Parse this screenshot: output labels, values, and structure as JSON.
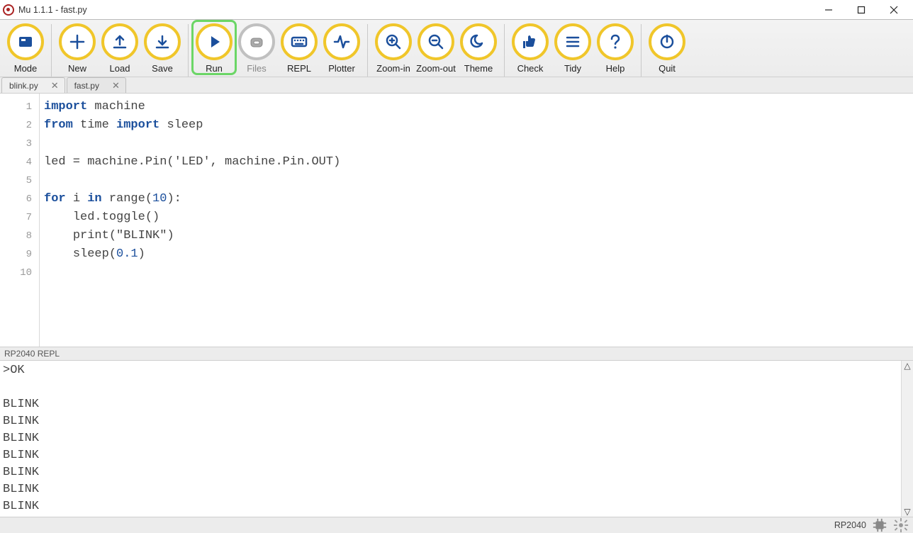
{
  "window": {
    "title": "Mu 1.1.1 - fast.py"
  },
  "toolbar": {
    "items": [
      {
        "id": "mode",
        "label": "Mode",
        "icon": "mode",
        "disabled": false,
        "highlight": false,
        "sep_after": true
      },
      {
        "id": "new",
        "label": "New",
        "icon": "plus",
        "disabled": false,
        "highlight": false,
        "sep_after": false
      },
      {
        "id": "load",
        "label": "Load",
        "icon": "upload",
        "disabled": false,
        "highlight": false,
        "sep_after": false
      },
      {
        "id": "save",
        "label": "Save",
        "icon": "download",
        "disabled": false,
        "highlight": false,
        "sep_after": true
      },
      {
        "id": "run",
        "label": "Run",
        "icon": "play",
        "disabled": false,
        "highlight": true,
        "sep_after": false
      },
      {
        "id": "files",
        "label": "Files",
        "icon": "files",
        "disabled": true,
        "highlight": false,
        "sep_after": false
      },
      {
        "id": "repl",
        "label": "REPL",
        "icon": "keyboard",
        "disabled": false,
        "highlight": false,
        "sep_after": false
      },
      {
        "id": "plotter",
        "label": "Plotter",
        "icon": "pulse",
        "disabled": false,
        "highlight": false,
        "sep_after": true
      },
      {
        "id": "zoomin",
        "label": "Zoom-in",
        "icon": "zoomin",
        "disabled": false,
        "highlight": false,
        "sep_after": false
      },
      {
        "id": "zoomout",
        "label": "Zoom-out",
        "icon": "zoomout",
        "disabled": false,
        "highlight": false,
        "sep_after": false
      },
      {
        "id": "theme",
        "label": "Theme",
        "icon": "moon",
        "disabled": false,
        "highlight": false,
        "sep_after": true
      },
      {
        "id": "check",
        "label": "Check",
        "icon": "thumb",
        "disabled": false,
        "highlight": false,
        "sep_after": false
      },
      {
        "id": "tidy",
        "label": "Tidy",
        "icon": "menu",
        "disabled": false,
        "highlight": false,
        "sep_after": false
      },
      {
        "id": "help",
        "label": "Help",
        "icon": "help",
        "disabled": false,
        "highlight": false,
        "sep_after": true
      },
      {
        "id": "quit",
        "label": "Quit",
        "icon": "power",
        "disabled": false,
        "highlight": false,
        "sep_after": false
      }
    ]
  },
  "tabs": [
    {
      "name": "blink.py",
      "active": false
    },
    {
      "name": "fast.py",
      "active": true
    }
  ],
  "editor": {
    "line_count": 10,
    "lines": [
      {
        "n": 1,
        "tokens": [
          [
            "kw",
            "import"
          ],
          [
            "sp",
            " "
          ],
          [
            "id",
            "machine"
          ]
        ]
      },
      {
        "n": 2,
        "tokens": [
          [
            "kw",
            "from"
          ],
          [
            "sp",
            " "
          ],
          [
            "id",
            "time"
          ],
          [
            "sp",
            " "
          ],
          [
            "kw",
            "import"
          ],
          [
            "sp",
            " "
          ],
          [
            "id",
            "sleep"
          ]
        ]
      },
      {
        "n": 3,
        "tokens": []
      },
      {
        "n": 4,
        "tokens": [
          [
            "id",
            "led = machine.Pin("
          ],
          [
            "str",
            "'LED'"
          ],
          [
            "id",
            ", machine.Pin.OUT)"
          ]
        ]
      },
      {
        "n": 5,
        "tokens": []
      },
      {
        "n": 6,
        "tokens": [
          [
            "kw",
            "for"
          ],
          [
            "sp",
            " "
          ],
          [
            "id",
            "i"
          ],
          [
            "sp",
            " "
          ],
          [
            "kw",
            "in"
          ],
          [
            "sp",
            " "
          ],
          [
            "id",
            "range("
          ],
          [
            "num",
            "10"
          ],
          [
            "id",
            "):"
          ]
        ]
      },
      {
        "n": 7,
        "tokens": [
          [
            "sp",
            "    "
          ],
          [
            "id",
            "led.toggle()"
          ]
        ]
      },
      {
        "n": 8,
        "tokens": [
          [
            "sp",
            "    "
          ],
          [
            "id",
            "print("
          ],
          [
            "str",
            "\"BLINK\""
          ],
          [
            "id",
            ")"
          ]
        ]
      },
      {
        "n": 9,
        "tokens": [
          [
            "sp",
            "    "
          ],
          [
            "id",
            "sleep("
          ],
          [
            "num",
            "0.1"
          ],
          [
            "id",
            ")"
          ]
        ]
      },
      {
        "n": 10,
        "tokens": []
      }
    ]
  },
  "repl": {
    "title": "RP2040 REPL",
    "lines": [
      ">OK",
      "",
      "BLINK",
      "BLINK",
      "BLINK",
      "BLINK",
      "BLINK",
      "BLINK",
      "BLINK"
    ]
  },
  "status": {
    "mode": "RP2040"
  }
}
